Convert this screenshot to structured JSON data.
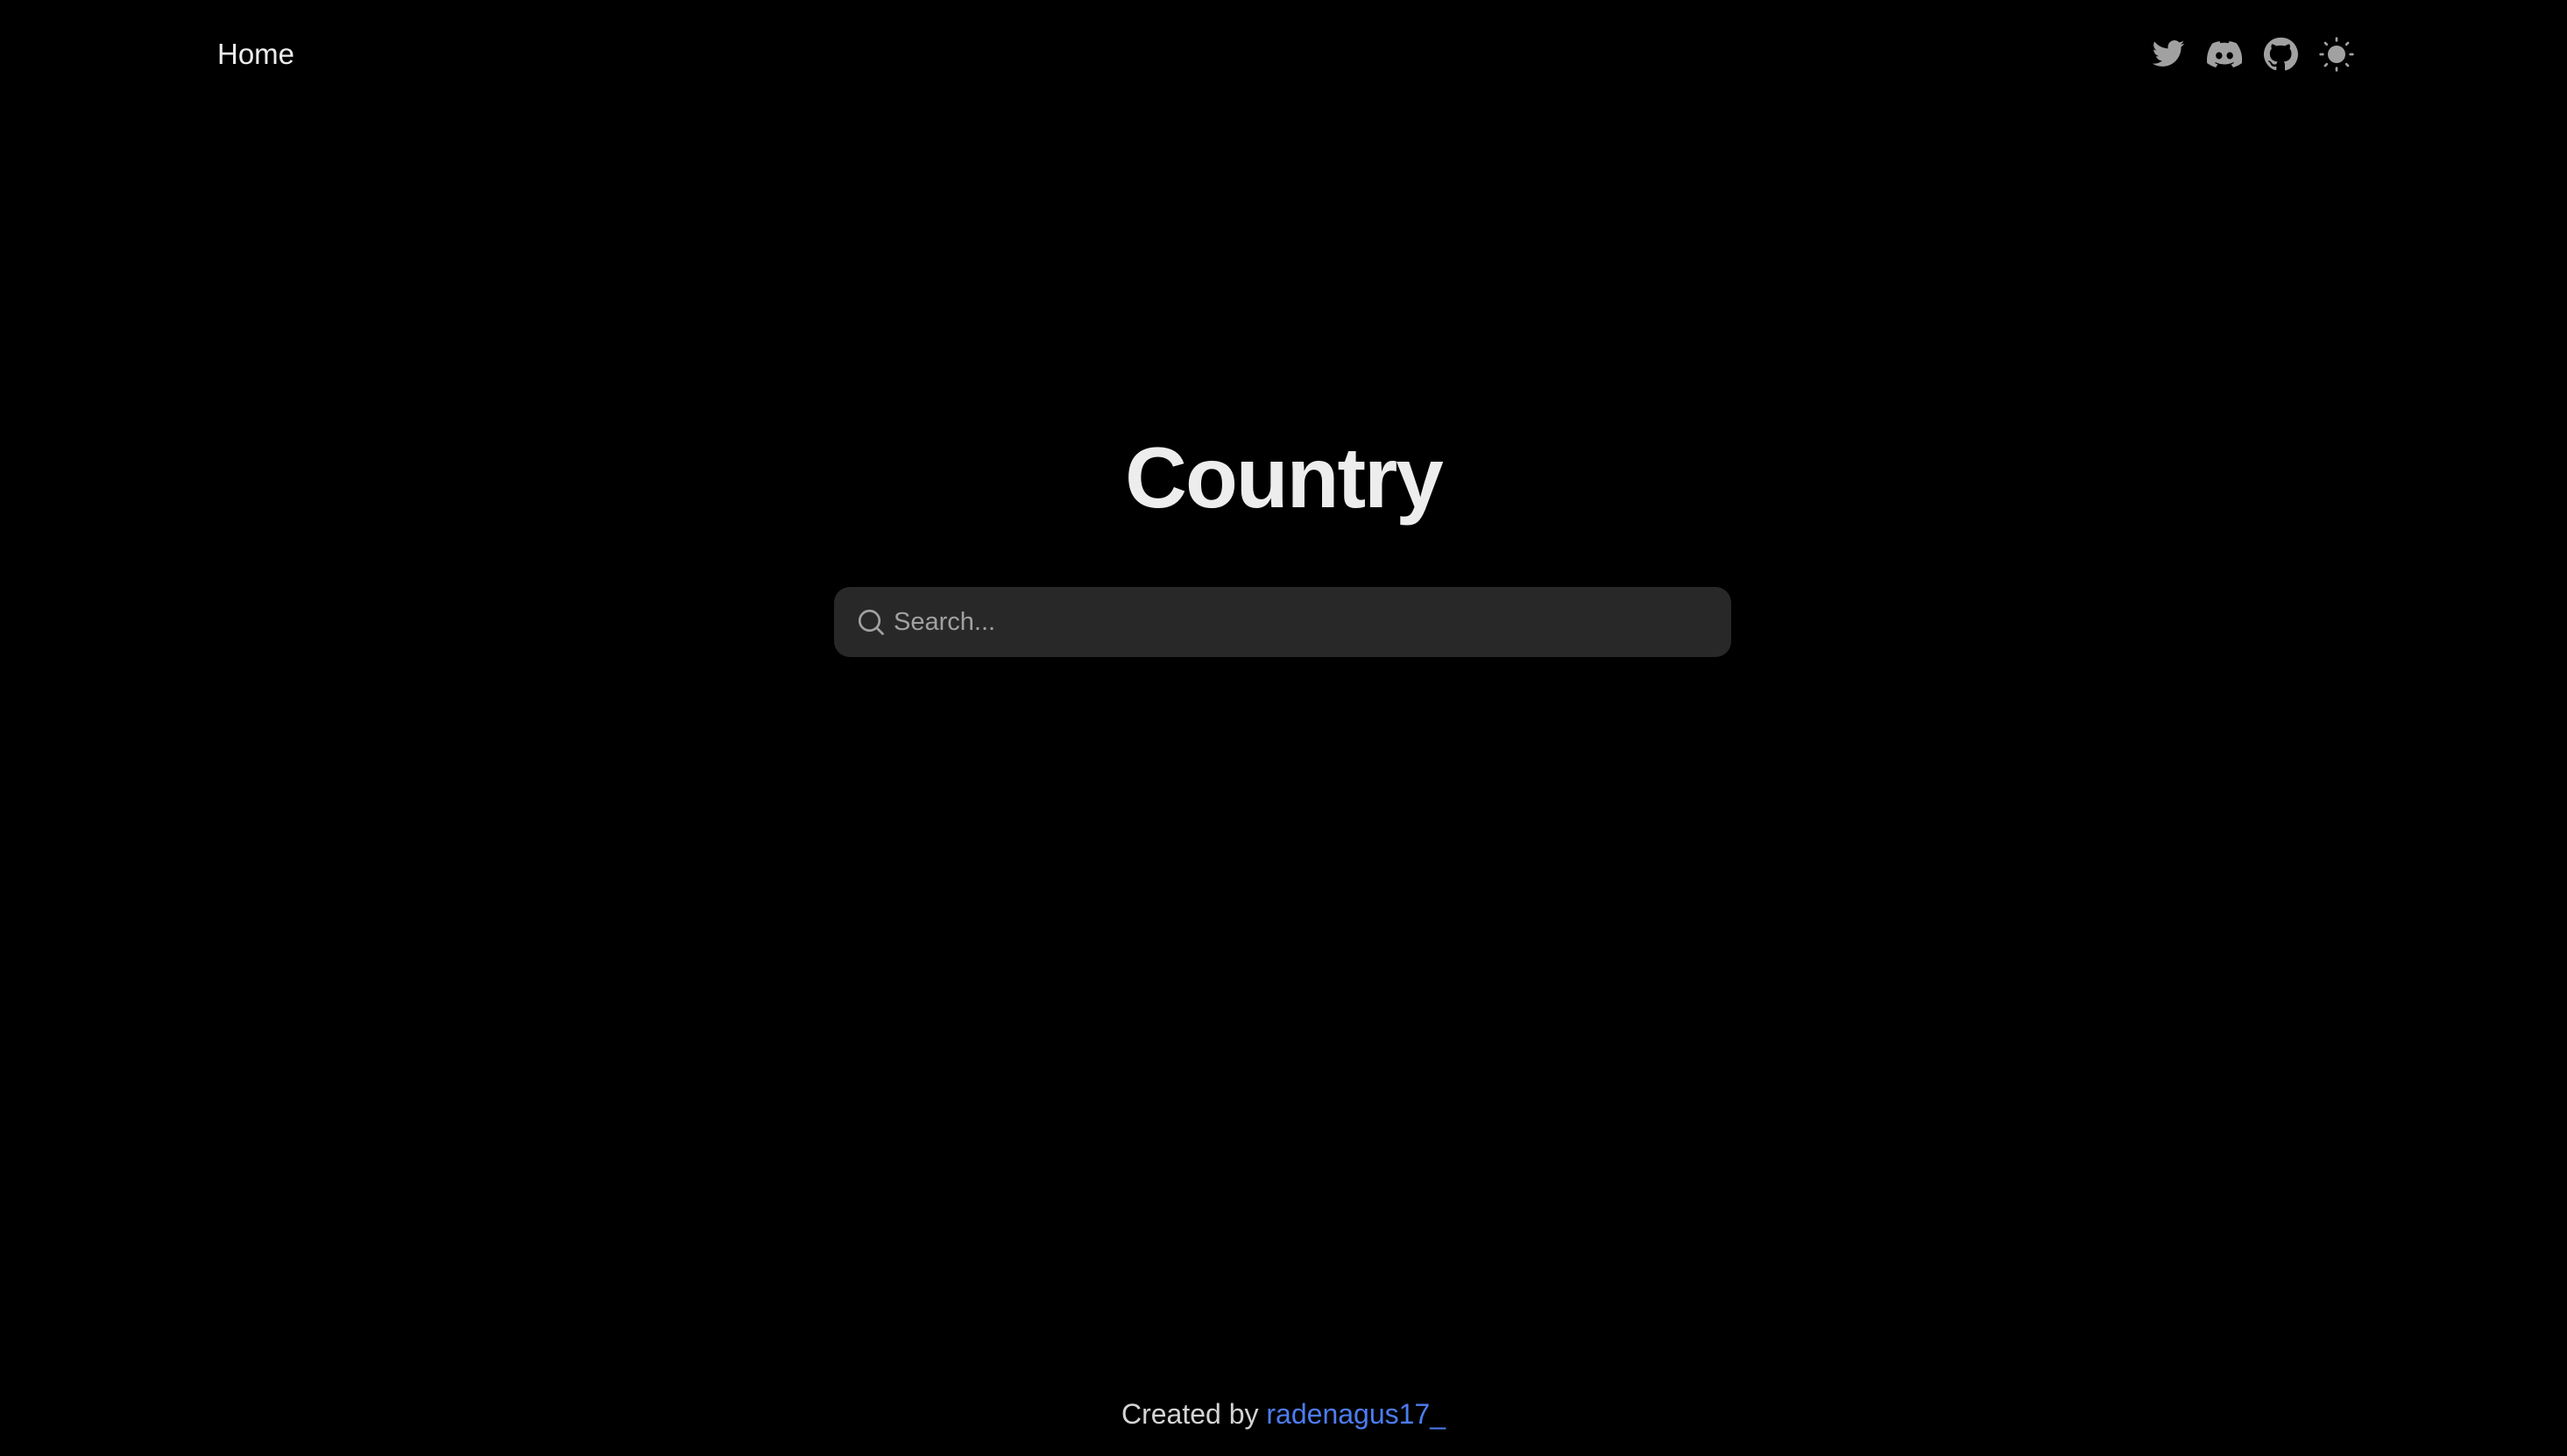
{
  "nav": {
    "home_label": "Home",
    "icons": [
      "twitter-icon",
      "discord-icon",
      "github-icon",
      "sun-icon"
    ]
  },
  "hero": {
    "title": "Country"
  },
  "search": {
    "placeholder": "Search...",
    "value": ""
  },
  "footer": {
    "prefix": "Created by",
    "author": "radenagus17_"
  },
  "colors": {
    "background": "#000000",
    "text": "#ededed",
    "search_bg": "#282828",
    "placeholder": "#a1a1a1",
    "icon": "#a1a1a1",
    "link": "#4d7cf0"
  }
}
